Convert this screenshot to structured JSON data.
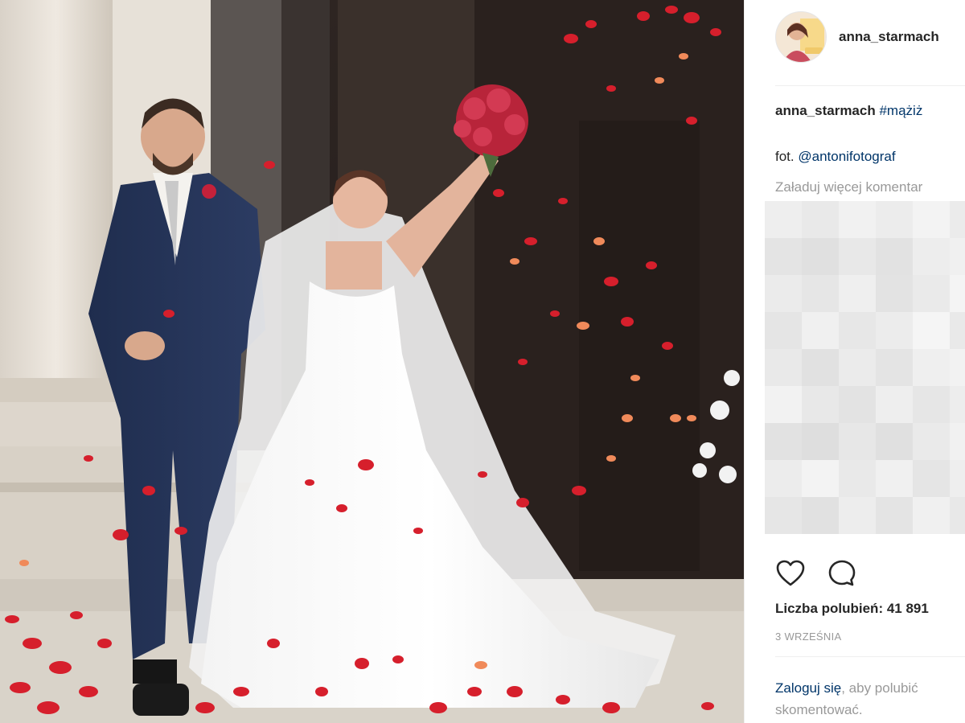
{
  "post": {
    "username": "anna_starmach",
    "caption_user": "anna_starmach",
    "caption_hashtag": "#mążiż",
    "credit_prefix": "fot.",
    "credit_mention": "@antonifotograf",
    "load_more_comments": "Załaduj więcej komentar",
    "likes_text": "Liczba polubień: 41 891",
    "date": "3 WRZEŚNIA",
    "login_link": "Zaloguj się",
    "login_rest_line1": ", aby polubić",
    "login_rest_line2": "skomentować."
  },
  "icons": {
    "like": "heart-icon",
    "comment": "comment-bubble-icon"
  },
  "colors": {
    "link": "#003569",
    "muted": "#999999",
    "text": "#262626",
    "divider": "#efefef"
  }
}
